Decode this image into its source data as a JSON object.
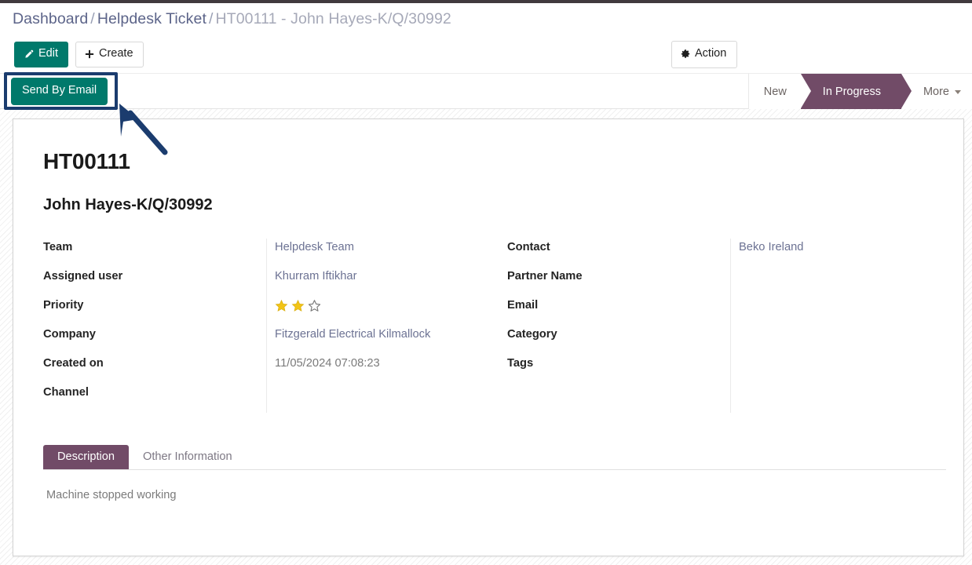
{
  "breadcrumb": {
    "items": [
      {
        "label": "Dashboard",
        "current": false
      },
      {
        "label": "Helpdesk Ticket",
        "current": false
      },
      {
        "label": "HT00111 - John Hayes-K/Q/30992",
        "current": true
      }
    ],
    "separator": "/"
  },
  "toolbar": {
    "edit_label": "Edit",
    "create_label": "Create",
    "action_label": "Action"
  },
  "statusbar": {
    "send_by_email_label": "Send By Email",
    "stages": [
      {
        "label": "New",
        "active": false
      },
      {
        "label": "In Progress",
        "active": true
      },
      {
        "label": "More",
        "active": false,
        "has_caret": true
      }
    ]
  },
  "record": {
    "title": "HT00111",
    "subtitle": "John Hayes-K/Q/30992"
  },
  "fields": {
    "left": [
      {
        "label": "Team",
        "value": "Helpdesk Team",
        "type": "link"
      },
      {
        "label": "Assigned user",
        "value": "Khurram Iftikhar",
        "type": "link"
      },
      {
        "label": "Priority",
        "value": "",
        "type": "stars"
      },
      {
        "label": "Company",
        "value": "Fitzgerald Electrical Kilmallock",
        "type": "link"
      },
      {
        "label": "Created on",
        "value": "11/05/2024 07:08:23",
        "type": "text"
      },
      {
        "label": "Channel",
        "value": "",
        "type": "text"
      }
    ],
    "right": [
      {
        "label": "Contact",
        "value": "Beko Ireland",
        "type": "link"
      },
      {
        "label": "Partner Name",
        "value": "",
        "type": "text"
      },
      {
        "label": "Email",
        "value": "",
        "type": "text"
      },
      {
        "label": "Category",
        "value": "",
        "type": "text"
      },
      {
        "label": "Tags",
        "value": "",
        "type": "text"
      }
    ]
  },
  "priority": {
    "filled": 2,
    "total": 3,
    "star_color": "#f2c416",
    "empty_color": "#7a7a7a"
  },
  "notebook": {
    "tabs": [
      {
        "label": "Description",
        "active": true
      },
      {
        "label": "Other Information",
        "active": false
      }
    ],
    "description_text": "Machine stopped working"
  },
  "annotation": {
    "highlight_target": "Send By Email",
    "highlight_color": "#1b3c6e",
    "arrow_color": "#1b3c6e"
  },
  "colors": {
    "primary_teal": "#00796b",
    "accent_purple": "#714b67",
    "breadcrumb_link": "#5c6489",
    "value_link": "#6c7293"
  }
}
